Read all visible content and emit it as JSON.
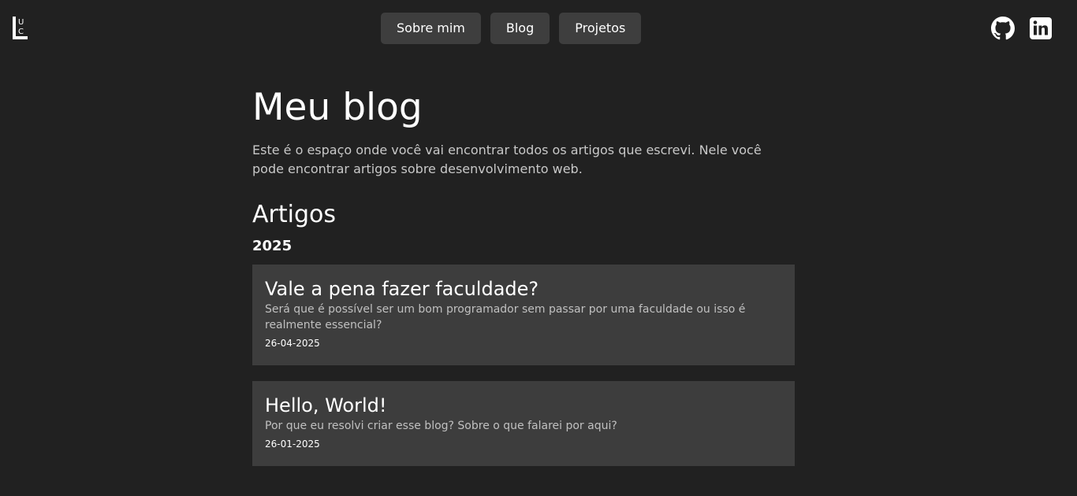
{
  "logo": {
    "text": "LUC"
  },
  "nav": {
    "items": [
      {
        "label": "Sobre mim"
      },
      {
        "label": "Blog"
      },
      {
        "label": "Projetos"
      }
    ]
  },
  "social": {
    "icons": [
      "github-icon",
      "linkedin-icon"
    ]
  },
  "page": {
    "title": "Meu blog",
    "intro": "Este é o espaço onde você vai encontrar todos os artigos que escrevi. Nele você pode encontrar artigos sobre desenvolvimento web.",
    "section_title": "Artigos",
    "year": "2025"
  },
  "articles": [
    {
      "title": "Vale a pena fazer faculdade?",
      "description": "Será que é possível ser um bom programador sem passar por uma faculdade ou isso é realmente essencial?",
      "date": "26-04-2025"
    },
    {
      "title": "Hello, World!",
      "description": "Por que eu resolvi criar esse blog? Sobre o que falarei por aqui?",
      "date": "26-01-2025"
    }
  ],
  "colors": {
    "background": "#212121",
    "surface": "#3d3d3d",
    "text": "#ffffff",
    "muted_text": "#c0c0c0"
  }
}
